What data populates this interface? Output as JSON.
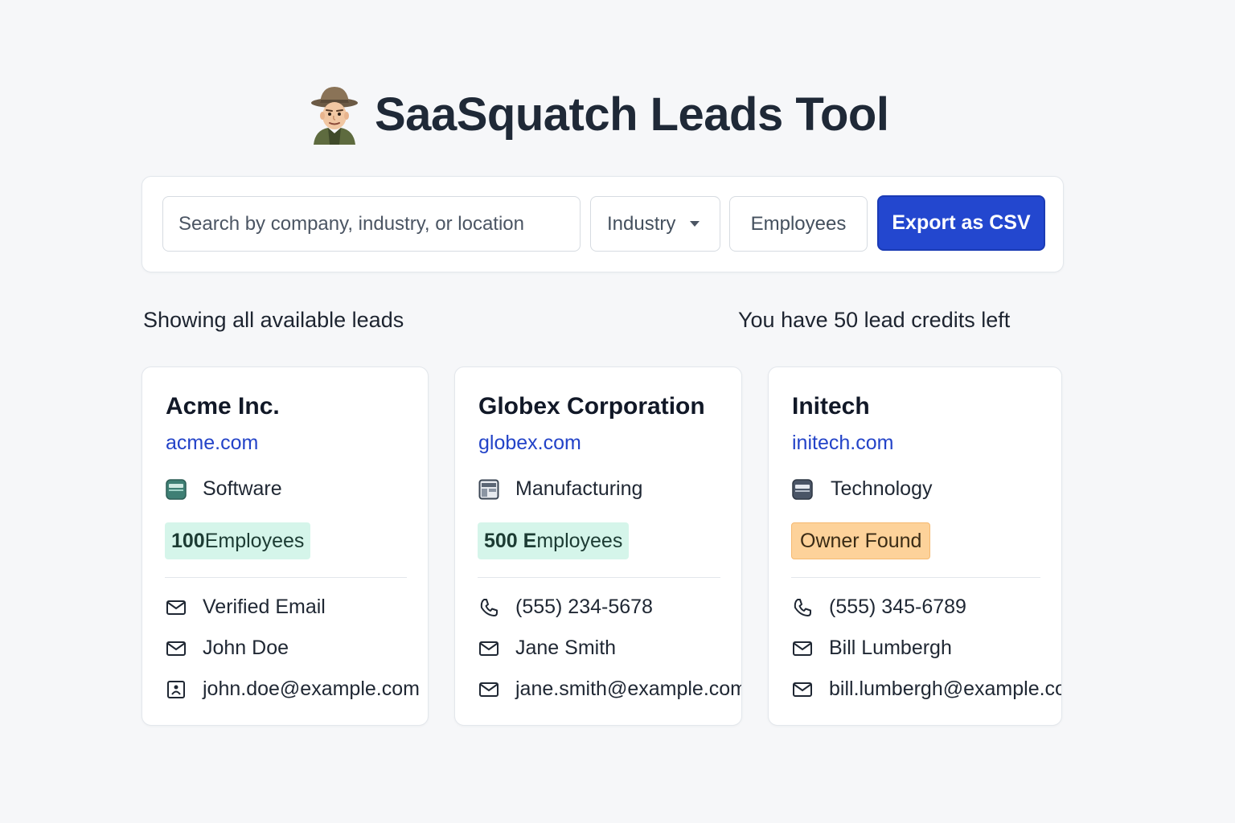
{
  "header": {
    "title": "SaaSquatch Leads Tool",
    "mascot_icon": "hat-person-mascot-icon"
  },
  "toolbar": {
    "search_placeholder": "Search by company, industry, or location",
    "industry_label": "Industry",
    "employees_label": "Employees",
    "export_label": "Export as CSV",
    "accent_color": "#2347cf"
  },
  "status": {
    "left": "Showing all available leads",
    "right": "You have 50 lead credits left"
  },
  "leads": [
    {
      "company": "Acme Inc.",
      "domain": "acme.com",
      "industry": "Software",
      "industry_icon": "software-icon",
      "badge_number": "100",
      "badge_rest": " Employees",
      "badge_color": "#d5f5ea",
      "contacts": [
        {
          "icon": "mail-icon",
          "text": "Verified Email"
        },
        {
          "icon": "mail-icon",
          "text": "John Doe"
        },
        {
          "icon": "id-card-icon",
          "text": "john.doe@example.com"
        }
      ]
    },
    {
      "company": "Globex Corporation",
      "domain": "globex.com",
      "industry": "Manufacturing",
      "industry_icon": "manufacturing-icon",
      "badge_number": "500 E",
      "badge_rest": "mployees",
      "badge_color": "#d5f5ea",
      "contacts": [
        {
          "icon": "phone-icon",
          "text": "(555) 234-5678"
        },
        {
          "icon": "mail-icon",
          "text": "Jane Smith"
        },
        {
          "icon": "mail-icon",
          "text": "jane.smith@example.com"
        }
      ]
    },
    {
      "company": "Initech",
      "domain": "initech.com",
      "industry": "Technology",
      "industry_icon": "technology-icon",
      "badge_text": "Owner Found",
      "badge_color": "#fdd29a",
      "contacts": [
        {
          "icon": "phone-icon",
          "text": "(555) 345-6789"
        },
        {
          "icon": "mail-icon",
          "text": "Bill Lumbergh"
        },
        {
          "icon": "mail-icon",
          "text": "bill.lumbergh@example.com"
        }
      ]
    }
  ]
}
